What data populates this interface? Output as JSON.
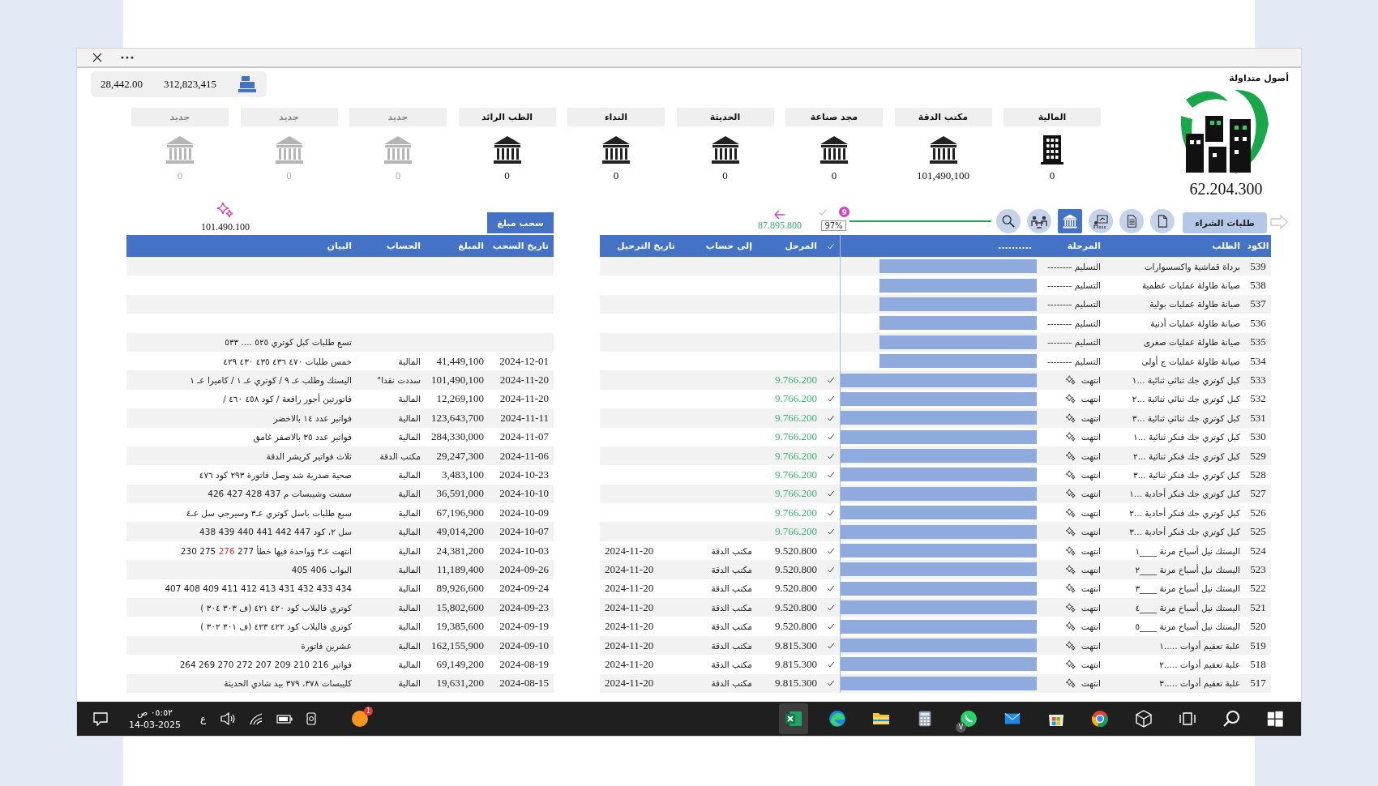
{
  "summary": {
    "value_1": "28,442.00",
    "value_2": "312,823,415"
  },
  "section_title": "أصول متداولة",
  "logo_value": "62.204.300",
  "accounts": [
    {
      "label": "المالية",
      "value": "0",
      "kind": "building",
      "disabled": false
    },
    {
      "label": "مكتب الدقة",
      "value": "101,490,100",
      "kind": "bank",
      "disabled": false
    },
    {
      "label": "مجد صناعة",
      "value": "0",
      "kind": "bank",
      "disabled": false
    },
    {
      "label": "الحديثة",
      "value": "0",
      "kind": "bank",
      "disabled": false
    },
    {
      "label": "النداء",
      "value": "0",
      "kind": "bank",
      "disabled": false
    },
    {
      "label": "الطب الرائد",
      "value": "0",
      "kind": "bank",
      "disabled": false
    },
    {
      "label": "جديد",
      "value": "0",
      "kind": "bank",
      "disabled": true
    },
    {
      "label": "جديد",
      "value": "0",
      "kind": "bank",
      "disabled": true
    },
    {
      "label": "جديد",
      "value": "0",
      "kind": "bank",
      "disabled": true
    }
  ],
  "toolbar": {
    "primary_button": "طلبات الشراء",
    "icons": [
      {
        "kind": "document",
        "selected": false
      },
      {
        "kind": "document-lines",
        "selected": false
      },
      {
        "kind": "presentation",
        "selected": false
      },
      {
        "kind": "bank",
        "selected": true
      },
      {
        "kind": "meeting",
        "selected": false
      },
      {
        "kind": "search",
        "selected": false
      }
    ],
    "progress_label": "97%",
    "badge": "9",
    "carried_amount": "87.895.800"
  },
  "withdraw": {
    "button": "سحب مبلغ",
    "value": "101.490.100"
  },
  "withdrawals": {
    "columns": [
      "تاريخ السحب",
      "المبلغ",
      "الحساب",
      "البيان"
    ],
    "rows": [
      {
        "description": "تسع طلبات كبل كوتري ٥٢٥ .... ٥٣٣"
      },
      {
        "date": "2024-12-01",
        "amount": "41,449,100",
        "account": "المالية",
        "description": "خمس طلبات ٤٧٠ ٤٣٦ ٤٣٥ ٤٣٠ ٤٢٩"
      },
      {
        "date": "2024-11-20",
        "amount": "101,490,100",
        "account": "سددت نقدا\"",
        "description": "اليستك وطلب عـ ٩ / كوتري عـ ١ / كاميرا عـ ١"
      },
      {
        "date": "2024-11-20",
        "amount": "12,269,100",
        "account": "المالية",
        "description": "فاتورتين أجور رافعة / كود ٤٥٨ ٤٦٠ /"
      },
      {
        "date": "2024-11-11",
        "amount": "123,643,700",
        "account": "المالية",
        "description": "فواتير عدد ١٤ بالاخضر"
      },
      {
        "date": "2024-11-07",
        "amount": "284,330,000",
        "account": "المالية",
        "description": "فواتير عدد ٣٥ بالاصفر غامق"
      },
      {
        "date": "2024-11-06",
        "amount": "29,247,300",
        "account": "مكتب الدقة",
        "description": "ثلاث فواتير كريشر الدقة"
      },
      {
        "date": "2024-10-23",
        "amount": "3,483,100",
        "account": "المالية",
        "description": "صحية صدرية شد وصل فاتورة ٢٩٣ كود ٤٧٦"
      },
      {
        "date": "2024-10-10",
        "amount": "36,591,000",
        "account": "المالية",
        "description": "سمنت وشيبسات م 437 428 427 426"
      },
      {
        "date": "2024-10-09",
        "amount": "67,196,900",
        "account": "المالية",
        "description": "سبع طلبات باسل كوتري عـ٣ وسيرجي سل عـ٤"
      },
      {
        "date": "2024-10-07",
        "amount": "49,014,200",
        "account": "المالية",
        "description": "سل ٢، كود 447 442 441 440 439 438"
      },
      {
        "date": "2024-10-03",
        "amount": "24,381,200",
        "account": "المالية",
        "description": "انتهت عـ٣ وَواحدة فيها خطأ 277",
        "flagged": "276",
        "description_end": "275 230"
      },
      {
        "date": "2024-09-26",
        "amount": "11,189,400",
        "account": "المالية",
        "description": "البواب 406 405"
      },
      {
        "date": "2024-09-24",
        "amount": "89,926,600",
        "account": "المالية",
        "description": "434 433 432 431 413 412 411 409 408 407"
      },
      {
        "date": "2024-09-23",
        "amount": "15,802,600",
        "account": "المالية",
        "description": "كوتري فاليلاب كود ٤٢٠ ٤٢١ (ف ٣٠٣ ٣٠٤ )"
      },
      {
        "date": "2024-09-19",
        "amount": "19,385,600",
        "account": "المالية",
        "description": "كوتري فاليلاب كود ٤٢٢ ٤٢٣ (ف ٣٠١ ٣٠٢ )"
      },
      {
        "date": "2024-09-10",
        "amount": "162,155,900",
        "account": "المالية",
        "description": "عشرين فاتورة"
      },
      {
        "date": "2024-08-19",
        "amount": "69,149,200",
        "account": "المالية",
        "description": "فواتير 216 210 209 207 272 270 269 264"
      },
      {
        "date": "2024-08-15",
        "amount": "19,631,200",
        "account": "المالية",
        "description": "كليبسات ٣٧٨، ٣٧٩ بيد شادي الحديثة"
      }
    ]
  },
  "requests": {
    "columns": [
      "الكود",
      "الطلب",
      "المرحلة",
      "..........",
      "المرحل",
      "إلى حساب",
      "تاريخ الترحيل"
    ],
    "rows": [
      {
        "code": "539",
        "request": "برداة قماشية واكسسوارات",
        "stage": "التسليم --------",
        "kind": "pending",
        "level": 0.8,
        "checked": false
      },
      {
        "code": "538",
        "request": "صيانة طاولة عمليات عظمية",
        "stage": "التسليم --------",
        "kind": "pending",
        "level": 0.8,
        "checked": false
      },
      {
        "code": "537",
        "request": "صيانة طاولة عمليات بولية",
        "stage": "التسليم --------",
        "kind": "pending",
        "level": 0.8,
        "checked": false
      },
      {
        "code": "536",
        "request": "صيانة طاولة عمليات أذنية",
        "stage": "التسليم --------",
        "kind": "pending",
        "level": 0.8,
        "checked": false
      },
      {
        "code": "535",
        "request": "صيانة طاولة عمليات صغرى",
        "stage": "التسليم --------",
        "kind": "pending",
        "level": 0.8,
        "checked": false
      },
      {
        "code": "534",
        "request": "صيانة طاولة عمليات ج أولى",
        "stage": "التسليم --------",
        "kind": "pending",
        "level": 0.8,
        "checked": false
      },
      {
        "code": "533",
        "request": "كبل كوتري جك ثنائي ثنائية ...١",
        "stage": "انتهت",
        "kind": "done",
        "level": 1,
        "checked": true,
        "amount": "9.766.200",
        "posted": false
      },
      {
        "code": "532",
        "request": "كبل كوتري جك ثنائي ثنائية ...٢",
        "stage": "انتهت",
        "kind": "done",
        "level": 1,
        "checked": true,
        "amount": "9.766.200",
        "posted": false
      },
      {
        "code": "531",
        "request": "كبل كوتري جك ثنائي ثنائية ...٣",
        "stage": "انتهت",
        "kind": "done",
        "level": 1,
        "checked": true,
        "amount": "9.766.200",
        "posted": false
      },
      {
        "code": "530",
        "request": "كبل كوتري جك فنكر ثنائية ...١",
        "stage": "انتهت",
        "kind": "done",
        "level": 1,
        "checked": true,
        "amount": "9.766.200",
        "posted": false
      },
      {
        "code": "529",
        "request": "كبل كوتري جك فنكر ثنائية ...٢",
        "stage": "انتهت",
        "kind": "done",
        "level": 1,
        "checked": true,
        "amount": "9.766.200",
        "posted": false
      },
      {
        "code": "528",
        "request": "كبل كوتري جك فنكر ثنائية ...٣",
        "stage": "انتهت",
        "kind": "done",
        "level": 1,
        "checked": true,
        "amount": "9.766.200",
        "posted": false
      },
      {
        "code": "527",
        "request": "كبل كوتري جك فنكر أحادية ...١",
        "stage": "انتهت",
        "kind": "done",
        "level": 1,
        "checked": true,
        "amount": "9.766.200",
        "posted": false
      },
      {
        "code": "526",
        "request": "كبل كوتري جك فنكر أحادية ...٢",
        "stage": "انتهت",
        "kind": "done",
        "level": 1,
        "checked": true,
        "amount": "9.766.200",
        "posted": false
      },
      {
        "code": "525",
        "request": "كبل كوتري جك فنكر أحادية ...٣",
        "stage": "انتهت",
        "kind": "done",
        "level": 1,
        "checked": true,
        "amount": "9.766.200",
        "posted": false
      },
      {
        "code": "524",
        "request": "اليستك نيل أسياخ مرنة ____١",
        "stage": "انتهت",
        "kind": "done",
        "level": 1,
        "checked": true,
        "amount": "9.520.800",
        "posted": true,
        "to_account": "مكتب الدقة",
        "date": "2024-11-20"
      },
      {
        "code": "523",
        "request": "اليستك نيل أسياخ مرنة ____٢",
        "stage": "انتهت",
        "kind": "done",
        "level": 1,
        "checked": true,
        "amount": "9.520.800",
        "posted": true,
        "to_account": "مكتب الدقة",
        "date": "2024-11-20"
      },
      {
        "code": "522",
        "request": "اليستك نيل أسياخ مرنة ____٣",
        "stage": "انتهت",
        "kind": "done",
        "level": 1,
        "checked": true,
        "amount": "9.520.800",
        "posted": true,
        "to_account": "مكتب الدقة",
        "date": "2024-11-20"
      },
      {
        "code": "521",
        "request": "اليستك نيل أسياخ مرنة ____٤",
        "stage": "انتهت",
        "kind": "done",
        "level": 1,
        "checked": true,
        "amount": "9.520.800",
        "posted": true,
        "to_account": "مكتب الدقة",
        "date": "2024-11-20"
      },
      {
        "code": "520",
        "request": "اليستك نيل أسياخ مرنة ____٥",
        "stage": "انتهت",
        "kind": "done",
        "level": 1,
        "checked": true,
        "amount": "9.520.800",
        "posted": true,
        "to_account": "مكتب الدقة",
        "date": "2024-11-20"
      },
      {
        "code": "519",
        "request": "علبة تعقيم أدوات .....١",
        "stage": "انتهت",
        "kind": "done",
        "level": 1,
        "checked": true,
        "amount": "9.815.300",
        "posted": true,
        "to_account": "مكتب الدقة",
        "date": "2024-11-20"
      },
      {
        "code": "518",
        "request": "علبة تعقيم أدوات .....٢",
        "stage": "انتهت",
        "kind": "done",
        "level": 1,
        "checked": true,
        "amount": "9.815.300",
        "posted": true,
        "to_account": "مكتب الدقة",
        "date": "2024-11-20"
      },
      {
        "code": "517",
        "request": "علبة تعقيم أدوات .....٣",
        "stage": "انتهت",
        "kind": "done",
        "level": 1,
        "checked": true,
        "amount": "9.815.300",
        "posted": true,
        "to_account": "مكتب الدقة",
        "date": "2024-11-20"
      }
    ]
  },
  "taskbar": {
    "time": "٠٥:٥٢ ص",
    "date": "14-03-2025",
    "language": "ع",
    "app_badge": "1",
    "apps": [
      {
        "kind": "spreadsheet",
        "selected": true
      },
      {
        "kind": "edge",
        "selected": false
      },
      {
        "kind": "folder",
        "selected": false
      },
      {
        "kind": "calculator",
        "selected": false
      },
      {
        "kind": "chat",
        "selected": false,
        "badge": "V"
      },
      {
        "kind": "mail",
        "selected": false
      },
      {
        "kind": "store",
        "selected": false
      },
      {
        "kind": "web",
        "selected": false
      },
      {
        "kind": "cube",
        "selected": false
      },
      {
        "kind": "taskview",
        "selected": false
      },
      {
        "kind": "search",
        "selected": false
      },
      {
        "kind": "start",
        "selected": false
      }
    ]
  }
}
